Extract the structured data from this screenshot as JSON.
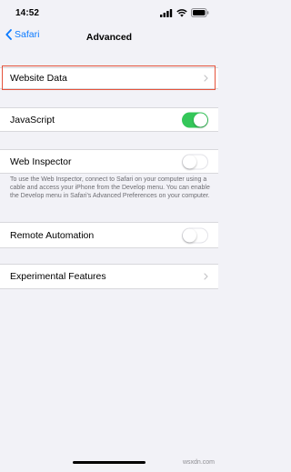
{
  "status_bar": {
    "time": "14:52"
  },
  "nav": {
    "back_label": "Safari",
    "title": "Advanced"
  },
  "rows": {
    "website_data": "Website Data",
    "javascript": "JavaScript",
    "web_inspector": "Web Inspector",
    "remote_automation": "Remote Automation",
    "experimental_features": "Experimental Features"
  },
  "toggles": {
    "javascript": true,
    "web_inspector": false,
    "remote_automation": false
  },
  "footnote": "To use the Web Inspector, connect to Safari on your computer using a cable and access your iPhone from the Develop menu. You can enable the Develop menu in Safari's Advanced Preferences on your computer.",
  "watermark": "wsxdn.com",
  "colors": {
    "accent": "#0a7aff",
    "toggle_on": "#34c759",
    "highlight": "#e5533c"
  }
}
